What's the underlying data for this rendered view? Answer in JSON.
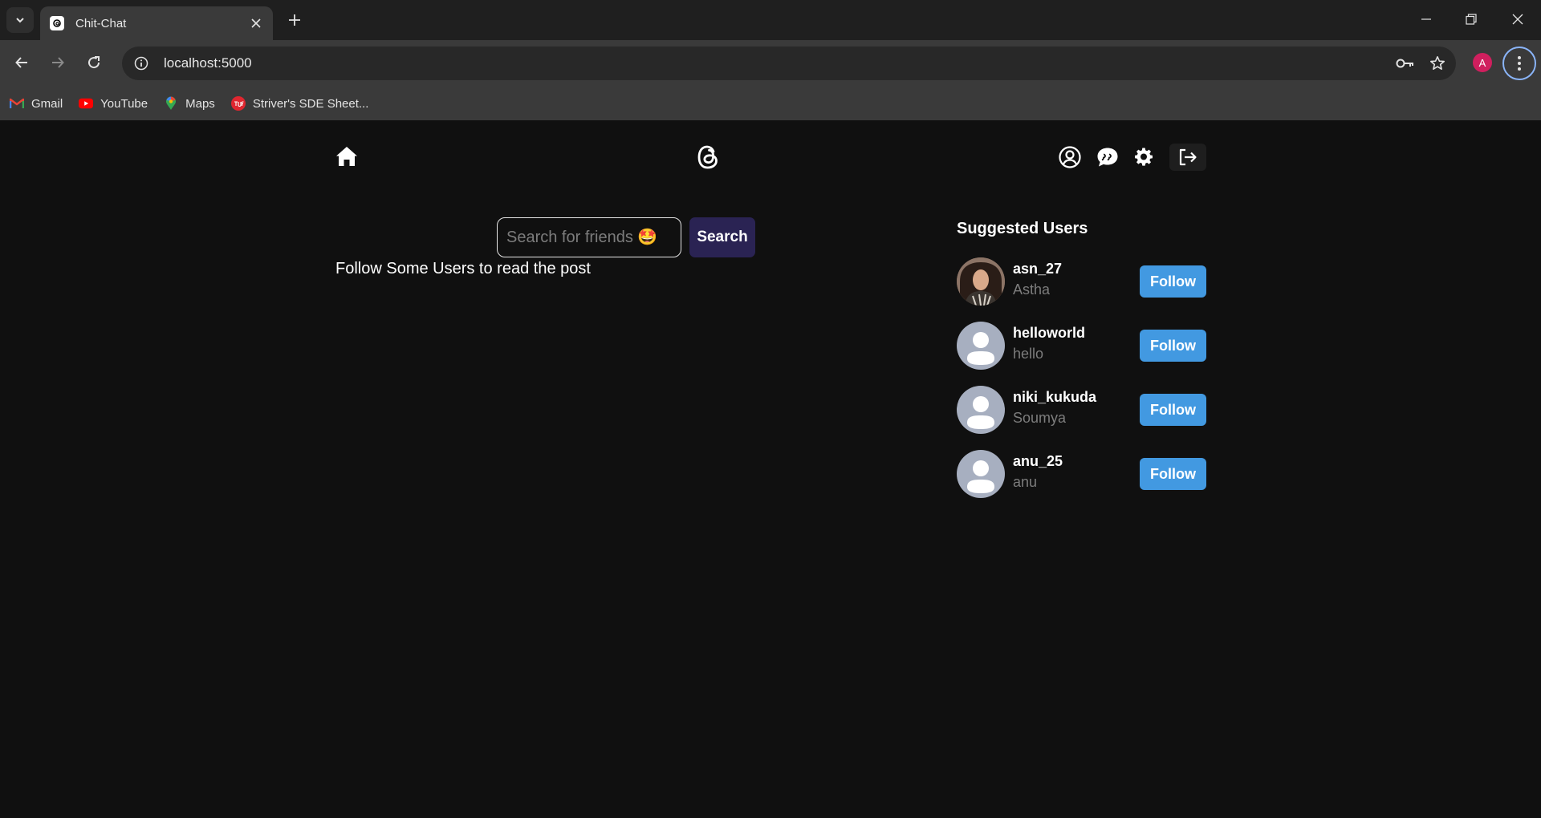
{
  "browser": {
    "tab_title": "Chit-Chat",
    "url": "localhost:5000",
    "profile_initial": "A",
    "bookmarks": [
      {
        "label": "Gmail",
        "icon": "gmail-icon"
      },
      {
        "label": "YouTube",
        "icon": "youtube-icon"
      },
      {
        "label": "Maps",
        "icon": "maps-icon"
      },
      {
        "label": "Striver's SDE Sheet...",
        "icon": "tuf-icon"
      }
    ]
  },
  "header": {
    "icons": [
      "home-icon",
      "threads-logo-icon",
      "profile-icon",
      "chat-icon",
      "settings-icon",
      "logout-icon"
    ]
  },
  "search": {
    "placeholder": "Search for friends 🤩",
    "button_label": "Search"
  },
  "feed": {
    "empty_message": "Follow Some Users to read the post"
  },
  "suggested": {
    "title": "Suggested Users",
    "follow_label": "Follow",
    "users": [
      {
        "username": "asn_27",
        "name": "Astha",
        "has_photo": true
      },
      {
        "username": "helloworld",
        "name": "hello",
        "has_photo": false
      },
      {
        "username": "niki_kukuda",
        "name": "Soumya",
        "has_photo": false
      },
      {
        "username": "anu_25",
        "name": "anu",
        "has_photo": false
      }
    ]
  },
  "colors": {
    "page_bg": "#101010",
    "follow_button": "#4299e1",
    "search_button": "#2a2353",
    "profile_avatar": "#d01f5e"
  }
}
